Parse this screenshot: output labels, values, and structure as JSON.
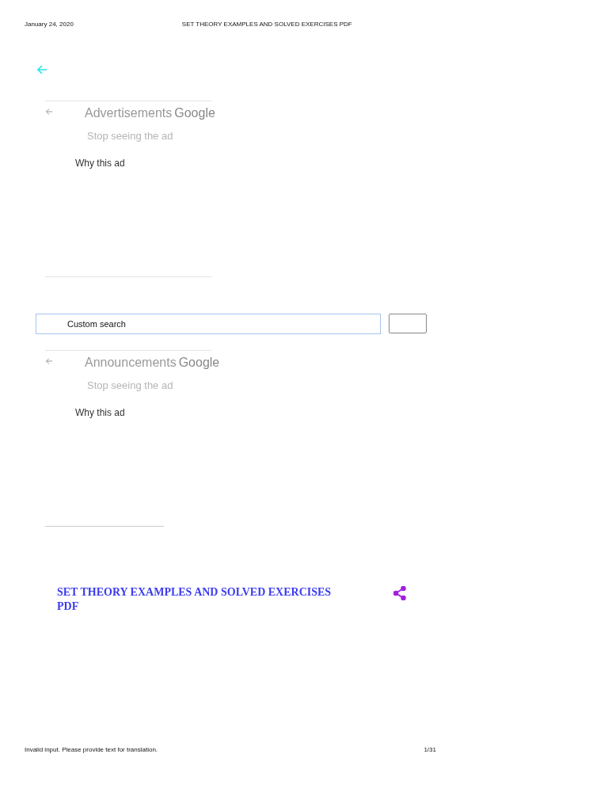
{
  "print_header": {
    "date": "January 24, 2020",
    "title": "SET THEORY EXAMPLES AND SOLVED EXERCISES PDF"
  },
  "ads": [
    {
      "label": "Advertisements",
      "brand": "Google",
      "stop": "Stop seeing the ad",
      "why": "Why this ad"
    },
    {
      "label": "Announcements",
      "brand": "Google",
      "stop": "Stop seeing the ad",
      "why": "Why this ad"
    }
  ],
  "search": {
    "value": "Custom search"
  },
  "post": {
    "title": "SET THEORY EXAMPLES AND SOLVED EXERCISES PDF"
  },
  "print_footer": {
    "note": "Invalid input. Please provide text for translation.",
    "page": "1/31"
  }
}
